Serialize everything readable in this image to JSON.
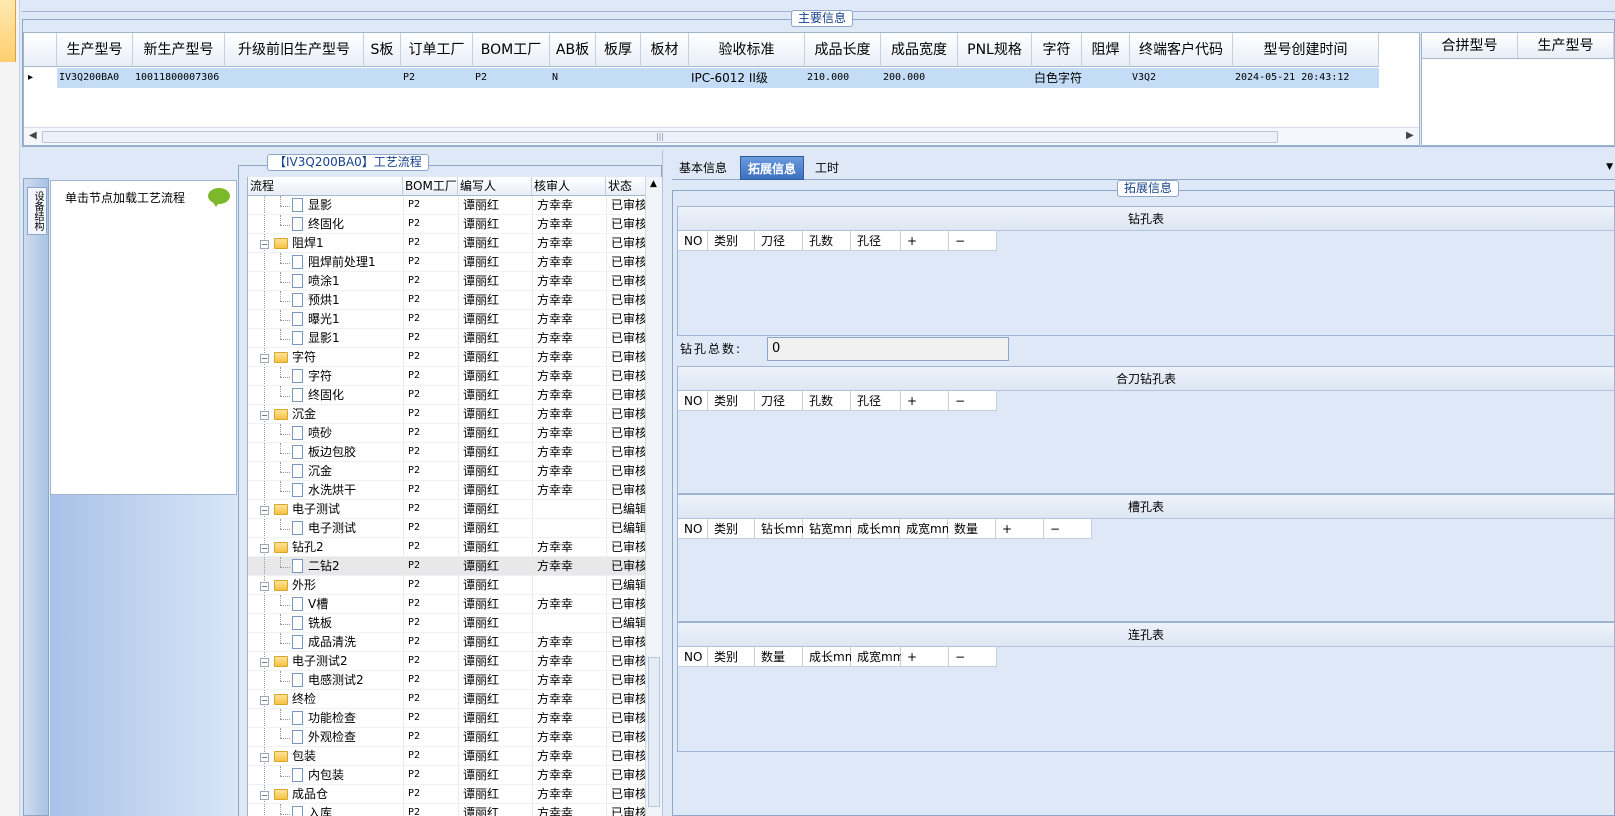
{
  "main": {
    "title": "主要信息",
    "columns": [
      "生产型号",
      "新生产型号",
      "升级前旧生产型号",
      "S板",
      "订单工厂",
      "BOM工厂",
      "AB板",
      "板厚",
      "板材",
      "验收标准",
      "成品长度",
      "成品宽度",
      "PNL规格",
      "字符",
      "阻焊",
      "终端客户代码",
      "型号创建时间"
    ],
    "row": [
      "IV3Q200BA0",
      "10011800007306",
      "",
      "",
      "P2",
      "P2",
      "N",
      "",
      "",
      "IPC-6012 II级",
      "210.000",
      "200.000",
      "",
      "白色字符",
      "",
      "V3Q2",
      "2024-05-21 20:43:12"
    ],
    "side_columns": [
      "合拼型号",
      "生产型号"
    ]
  },
  "side_tab_label": "设备结构",
  "tree_hint": "单击节点加载工艺流程",
  "flow": {
    "title": "【IV3Q200BA0】工艺流程",
    "columns": [
      "流程",
      "BOM工厂",
      "编写人",
      "核审人",
      "状态"
    ],
    "rows": [
      {
        "name": "显影",
        "bom": "P2",
        "writer": "谭丽红",
        "reviewer": "方幸幸",
        "status": "已审核",
        "level": 2
      },
      {
        "name": "终固化",
        "bom": "P2",
        "writer": "谭丽红",
        "reviewer": "方幸幸",
        "status": "已审核",
        "level": 2
      },
      {
        "name": "阻焊1",
        "bom": "P2",
        "writer": "谭丽红",
        "reviewer": "方幸幸",
        "status": "已审核",
        "level": 1
      },
      {
        "name": "阻焊前处理1",
        "bom": "P2",
        "writer": "谭丽红",
        "reviewer": "方幸幸",
        "status": "已审核",
        "level": 2
      },
      {
        "name": "喷涂1",
        "bom": "P2",
        "writer": "谭丽红",
        "reviewer": "方幸幸",
        "status": "已审核",
        "level": 2
      },
      {
        "name": "预烘1",
        "bom": "P2",
        "writer": "谭丽红",
        "reviewer": "方幸幸",
        "status": "已审核",
        "level": 2
      },
      {
        "name": "曝光1",
        "bom": "P2",
        "writer": "谭丽红",
        "reviewer": "方幸幸",
        "status": "已审核",
        "level": 2
      },
      {
        "name": "显影1",
        "bom": "P2",
        "writer": "谭丽红",
        "reviewer": "方幸幸",
        "status": "已审核",
        "level": 2
      },
      {
        "name": "字符",
        "bom": "P2",
        "writer": "谭丽红",
        "reviewer": "方幸幸",
        "status": "已审核",
        "level": 1
      },
      {
        "name": "字符",
        "bom": "P2",
        "writer": "谭丽红",
        "reviewer": "方幸幸",
        "status": "已审核",
        "level": 2
      },
      {
        "name": "终固化",
        "bom": "P2",
        "writer": "谭丽红",
        "reviewer": "方幸幸",
        "status": "已审核",
        "level": 2
      },
      {
        "name": "沉金",
        "bom": "P2",
        "writer": "谭丽红",
        "reviewer": "方幸幸",
        "status": "已审核",
        "level": 1
      },
      {
        "name": "喷砂",
        "bom": "P2",
        "writer": "谭丽红",
        "reviewer": "方幸幸",
        "status": "已审核",
        "level": 2
      },
      {
        "name": "板边包胶",
        "bom": "P2",
        "writer": "谭丽红",
        "reviewer": "方幸幸",
        "status": "已审核",
        "level": 2
      },
      {
        "name": "沉金",
        "bom": "P2",
        "writer": "谭丽红",
        "reviewer": "方幸幸",
        "status": "已审核",
        "level": 2
      },
      {
        "name": "水洗烘干",
        "bom": "P2",
        "writer": "谭丽红",
        "reviewer": "方幸幸",
        "status": "已审核",
        "level": 2
      },
      {
        "name": "电子测试",
        "bom": "P2",
        "writer": "谭丽红",
        "reviewer": "",
        "status": "已编辑",
        "level": 1
      },
      {
        "name": "电子测试",
        "bom": "P2",
        "writer": "谭丽红",
        "reviewer": "",
        "status": "已编辑",
        "level": 2
      },
      {
        "name": "钻孔2",
        "bom": "P2",
        "writer": "谭丽红",
        "reviewer": "方幸幸",
        "status": "已审核",
        "level": 1
      },
      {
        "name": "二钻2",
        "bom": "P2",
        "writer": "谭丽红",
        "reviewer": "方幸幸",
        "status": "已审核",
        "level": 2,
        "selected": true
      },
      {
        "name": "外形",
        "bom": "P2",
        "writer": "谭丽红",
        "reviewer": "",
        "status": "已编辑",
        "level": 1
      },
      {
        "name": "V槽",
        "bom": "P2",
        "writer": "谭丽红",
        "reviewer": "方幸幸",
        "status": "已审核",
        "level": 2
      },
      {
        "name": "铣板",
        "bom": "P2",
        "writer": "谭丽红",
        "reviewer": "",
        "status": "已编辑",
        "level": 2
      },
      {
        "name": "成品清洗",
        "bom": "P2",
        "writer": "谭丽红",
        "reviewer": "方幸幸",
        "status": "已审核",
        "level": 2
      },
      {
        "name": "电子测试2",
        "bom": "P2",
        "writer": "谭丽红",
        "reviewer": "方幸幸",
        "status": "已审核",
        "level": 1
      },
      {
        "name": "电感测试2",
        "bom": "P2",
        "writer": "谭丽红",
        "reviewer": "方幸幸",
        "status": "已审核",
        "level": 2
      },
      {
        "name": "终检",
        "bom": "P2",
        "writer": "谭丽红",
        "reviewer": "方幸幸",
        "status": "已审核",
        "level": 1
      },
      {
        "name": "功能检查",
        "bom": "P2",
        "writer": "谭丽红",
        "reviewer": "方幸幸",
        "status": "已审核",
        "level": 2
      },
      {
        "name": "外观检查",
        "bom": "P2",
        "writer": "谭丽红",
        "reviewer": "方幸幸",
        "status": "已审核",
        "level": 2
      },
      {
        "name": "包装",
        "bom": "P2",
        "writer": "谭丽红",
        "reviewer": "方幸幸",
        "status": "已审核",
        "level": 1
      },
      {
        "name": "内包装",
        "bom": "P2",
        "writer": "谭丽红",
        "reviewer": "方幸幸",
        "status": "已审核",
        "level": 2
      },
      {
        "name": "成品仓",
        "bom": "P2",
        "writer": "谭丽红",
        "reviewer": "方幸幸",
        "status": "已审核",
        "level": 1
      },
      {
        "name": "入库",
        "bom": "P2",
        "writer": "谭丽红",
        "reviewer": "方幸幸",
        "status": "已审核",
        "level": 2
      }
    ]
  },
  "tabs": [
    "基本信息",
    "拓展信息",
    "工时"
  ],
  "active_tab": "拓展信息",
  "ext": {
    "title": "拓展信息",
    "drill": {
      "caption": "钻孔表",
      "columns": [
        "NO",
        "类别",
        "刀径",
        "孔数",
        "孔径",
        "+",
        "−"
      ]
    },
    "drill_total_label": "钻孔总数:",
    "drill_total_value": "0",
    "combo_drill": {
      "caption": "合刀钻孔表",
      "columns": [
        "NO",
        "类别",
        "刀径",
        "孔数",
        "孔径",
        "+",
        "−"
      ]
    },
    "slot": {
      "caption": "槽孔表",
      "columns": [
        "NO",
        "类别",
        "钻长mm",
        "钻宽mm",
        "成长mm",
        "成宽mm",
        "数量",
        "+",
        "−"
      ]
    },
    "link": {
      "caption": "连孔表",
      "columns": [
        "NO",
        "类别",
        "数量",
        "成长mm",
        "成宽mm",
        "+",
        "−"
      ]
    }
  }
}
